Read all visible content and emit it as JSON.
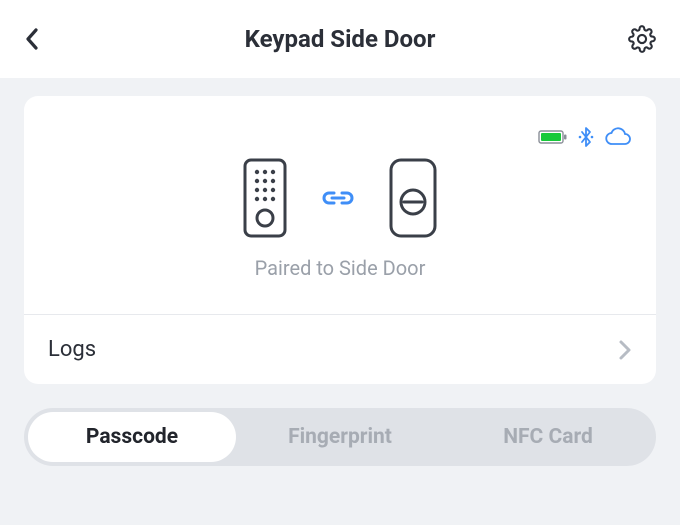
{
  "header": {
    "title": "Keypad Side Door"
  },
  "card": {
    "pairing_status": "Paired to Side Door",
    "logs_label": "Logs"
  },
  "segmented": {
    "tabs": [
      {
        "label": "Passcode",
        "active": true
      },
      {
        "label": "Fingerprint",
        "active": false
      },
      {
        "label": "NFC Card",
        "active": false
      }
    ]
  },
  "status": {
    "battery_color": "#17c93a",
    "bluetooth_color": "#3f8ef7",
    "cloud_color": "#3f8ef7"
  }
}
